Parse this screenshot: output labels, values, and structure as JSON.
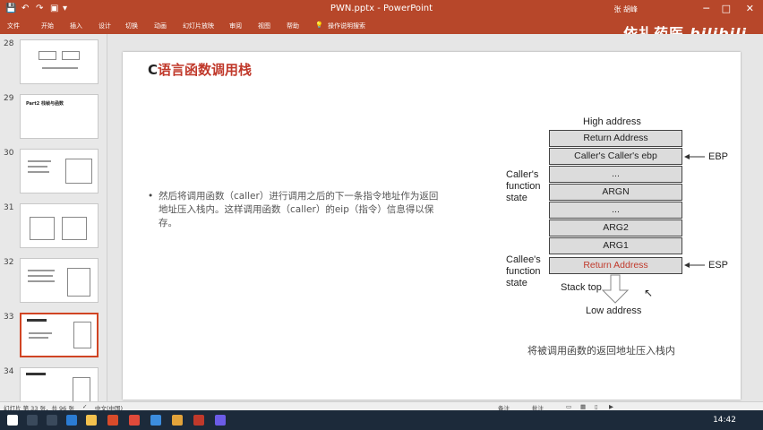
{
  "titlebar": {
    "doc_title": "PWN.pptx  -  PowerPoint",
    "user": "张 胡峰",
    "save_icon": "save-icon",
    "undo_icon": "undo-icon",
    "redo_icon": "redo-icon"
  },
  "ribbon": {
    "tabs": [
      "文件",
      "开始",
      "插入",
      "设计",
      "切换",
      "动画",
      "幻灯片放映",
      "审阅",
      "视图",
      "帮助"
    ],
    "tell_me": "操作说明搜索"
  },
  "watermark": {
    "cn": "依扎药医",
    "bili": "bilibili"
  },
  "thumbnails": [
    {
      "num": "28",
      "title": ""
    },
    {
      "num": "29",
      "title": "Part2 栈帧与函数"
    },
    {
      "num": "30",
      "title": ""
    },
    {
      "num": "31",
      "title": ""
    },
    {
      "num": "32",
      "title": ""
    },
    {
      "num": "33",
      "title": "",
      "active": true
    },
    {
      "num": "34",
      "title": ""
    }
  ],
  "slide": {
    "title_prefix": "C",
    "title_main": "语言函数调用栈",
    "bullet": "然后将调用函数（caller）进行调用之后的下一条指令地址作为返回地址压入栈内。这样调用函数（caller）的eip（指令）信息得以保存。",
    "caption": "将被调用函数的返回地址压入栈内"
  },
  "diagram": {
    "high_address": "High address",
    "low_address": "Low address",
    "stack_top": "Stack top",
    "callers_state": [
      "Caller's",
      "function",
      "state"
    ],
    "callees_state": [
      "Callee's",
      "function",
      "state"
    ],
    "ebp_label": "EBP",
    "esp_label": "ESP",
    "cells": [
      "Return Address",
      "Caller's Caller's ebp",
      "...",
      "ARGN",
      "...",
      "ARG2",
      "ARG1",
      "Return Address"
    ]
  },
  "statusbar": {
    "slide_info": "幻灯片 第 33 张，共 96 张",
    "language": "中文(中国)",
    "notes": "备注",
    "comments": "批注"
  },
  "taskbar": {
    "time": "14:42"
  }
}
